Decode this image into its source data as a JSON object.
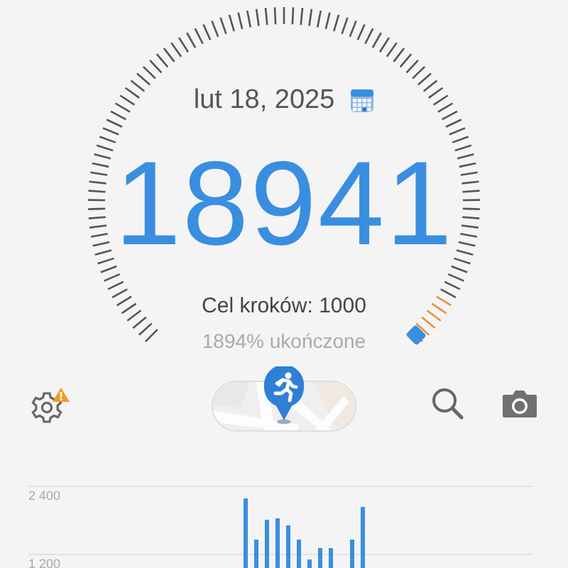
{
  "date": "lut 18, 2025",
  "steps": "18941",
  "goal": "Cel kroków: 1000",
  "progress_text": "1894% ukończone",
  "toolbar": {
    "settings_warning": true
  },
  "chart": {
    "axis_labels": [
      "2 400",
      "1 200"
    ]
  }
}
